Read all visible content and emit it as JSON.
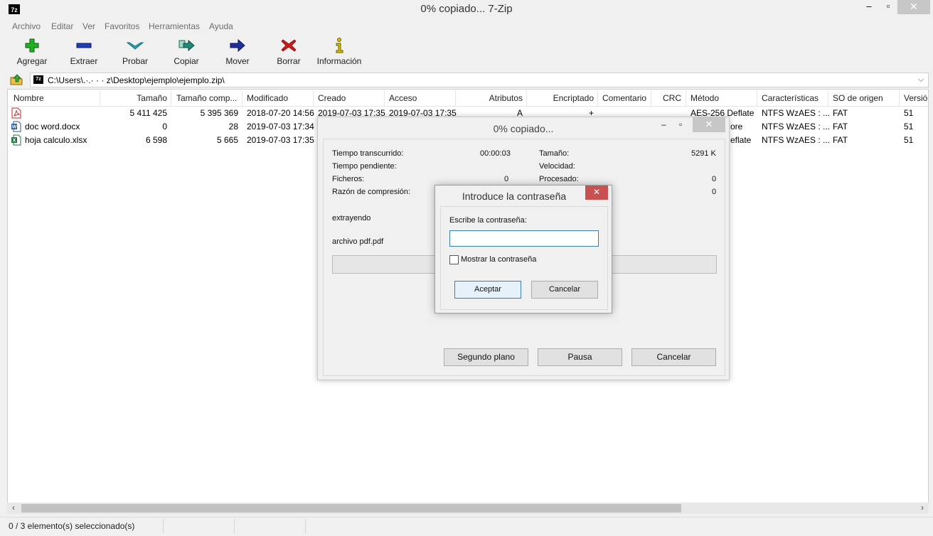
{
  "window": {
    "title": "0% copiado... 7-Zip",
    "app_icon": "7z",
    "controls": {
      "minimize": "‒",
      "maximize": "▫",
      "close": "✕"
    }
  },
  "menu": [
    "Archivo",
    "Editar",
    "Ver",
    "Favoritos",
    "Herramientas",
    "Ayuda"
  ],
  "toolbar": [
    {
      "label": "Agregar",
      "icon": "add-icon",
      "color": "#22b022"
    },
    {
      "label": "Extraer",
      "icon": "extract-icon",
      "color": "#1f3fb0"
    },
    {
      "label": "Probar",
      "icon": "test-icon",
      "color": "#2aa5b5"
    },
    {
      "label": "Copiar",
      "icon": "copy-icon",
      "color": "#1e8a7a"
    },
    {
      "label": "Mover",
      "icon": "move-icon",
      "color": "#1f2f9c"
    },
    {
      "label": "Borrar",
      "icon": "delete-icon",
      "color": "#d01818"
    },
    {
      "label": "Información",
      "icon": "info-icon",
      "color": "#d8c200"
    }
  ],
  "address": {
    "path": "C:\\Users\\.·.·  ·   ·  z\\Desktop\\ejemplo\\ejemplo.zip\\",
    "icon": "7z"
  },
  "columns": [
    "Nombre",
    "Tamaño",
    "Tamaño comp...",
    "Modificado",
    "Creado",
    "Acceso",
    "Atributos",
    "Encriptado",
    "Comentario",
    "CRC",
    "Método",
    "Características",
    "SO de origen",
    "Versió"
  ],
  "files": [
    {
      "icon": "pdf-file-icon",
      "icon_color": "#d02020",
      "name": "",
      "size": "5 411 425",
      "packed": "5 395 369",
      "modified": "2018-07-20 14:56",
      "created": "2019-07-03 17:35",
      "accessed": "2019-07-03 17:35",
      "attributes": "A",
      "encrypted": "+",
      "comment": "",
      "crc": "",
      "method": "AES-256 Deflate",
      "characteristics": "NTFS WzAES : ...",
      "host_os": "FAT",
      "version": "51"
    },
    {
      "icon": "word-file-icon",
      "icon_color": "#2b579a",
      "name": "doc word.docx",
      "size": "0",
      "packed": "28",
      "modified": "2019-07-03 17:34",
      "created": "",
      "accessed": "",
      "attributes": "",
      "encrypted": "",
      "comment": "",
      "crc": "",
      "method": "ore",
      "characteristics": "NTFS WzAES : ...",
      "host_os": "FAT",
      "version": "51"
    },
    {
      "icon": "excel-file-icon",
      "icon_color": "#217346",
      "name": "hoja calculo.xlsx",
      "size": "6 598",
      "packed": "5 665",
      "modified": "2019-07-03 17:35",
      "created": "",
      "accessed": "",
      "attributes": "",
      "encrypted": "",
      "comment": "",
      "crc": "",
      "method": "eflate",
      "characteristics": "NTFS WzAES : ...",
      "host_os": "FAT",
      "version": "51"
    }
  ],
  "scrollbar": {
    "left_arrow": "‹",
    "right_arrow": "›"
  },
  "status": {
    "text": "0 / 3 elemento(s) seleccionado(s)"
  },
  "progress_dialog": {
    "title": "0% copiado...",
    "controls": {
      "minimize": "‒",
      "maximize": "▫",
      "close": "✕"
    },
    "elapsed_label": "Tiempo transcurrido:",
    "elapsed_value": "00:00:03",
    "remaining_label": "Tiempo pendiente:",
    "remaining_value": "",
    "files_label": "Ficheros:",
    "files_value": "0",
    "ratio_label": "Razón de compresión:",
    "ratio_value": "",
    "size_label": "Tamaño:",
    "size_value": "5291 K",
    "speed_label": "Velocidad:",
    "speed_value": "",
    "processed_label": "Procesado:",
    "processed_value": "0",
    "packed_value": "0",
    "operation": "extrayendo",
    "current_file": "archivo pdf.pdf",
    "progress": 0,
    "buttons": {
      "background": "Segundo plano",
      "pause": "Pausa",
      "cancel": "Cancelar"
    }
  },
  "password_dialog": {
    "title": "Introduce la contraseña",
    "close": "✕",
    "prompt": "Escribe la contraseña:",
    "value": "",
    "show_password_label": "Mostrar la contraseña",
    "show_password_checked": false,
    "ok": "Aceptar",
    "cancel": "Cancelar"
  }
}
